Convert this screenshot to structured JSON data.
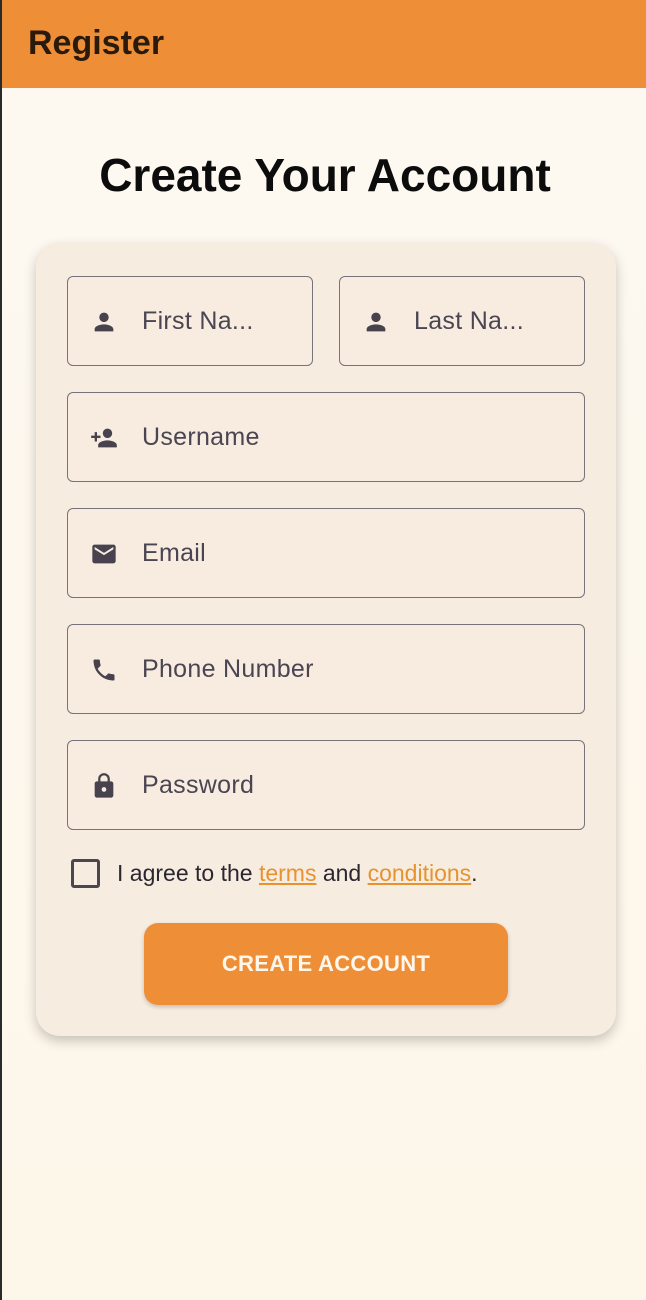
{
  "appbar": {
    "title": "Register",
    "color": "#ee8f38"
  },
  "page": {
    "title": "Create Your Account"
  },
  "form": {
    "first_name": {
      "placeholder": "First Na...",
      "icon": "person-icon"
    },
    "last_name": {
      "placeholder": "Last Na...",
      "icon": "person-icon"
    },
    "username": {
      "placeholder": "Username",
      "icon": "person-add-icon"
    },
    "email": {
      "placeholder": "Email",
      "icon": "mail-icon"
    },
    "phone": {
      "placeholder": "Phone Number",
      "icon": "phone-icon"
    },
    "password": {
      "placeholder": "Password",
      "icon": "lock-icon"
    },
    "agree": {
      "prefix": "I agree to the ",
      "terms": "terms",
      "middle": " and ",
      "conditions": "conditions",
      "suffix": ".",
      "checked": false
    },
    "submit_label": "CREATE ACCOUNT"
  },
  "colors": {
    "accent": "#ee8f38",
    "link": "#e8922f",
    "card": "#f7ece0"
  }
}
